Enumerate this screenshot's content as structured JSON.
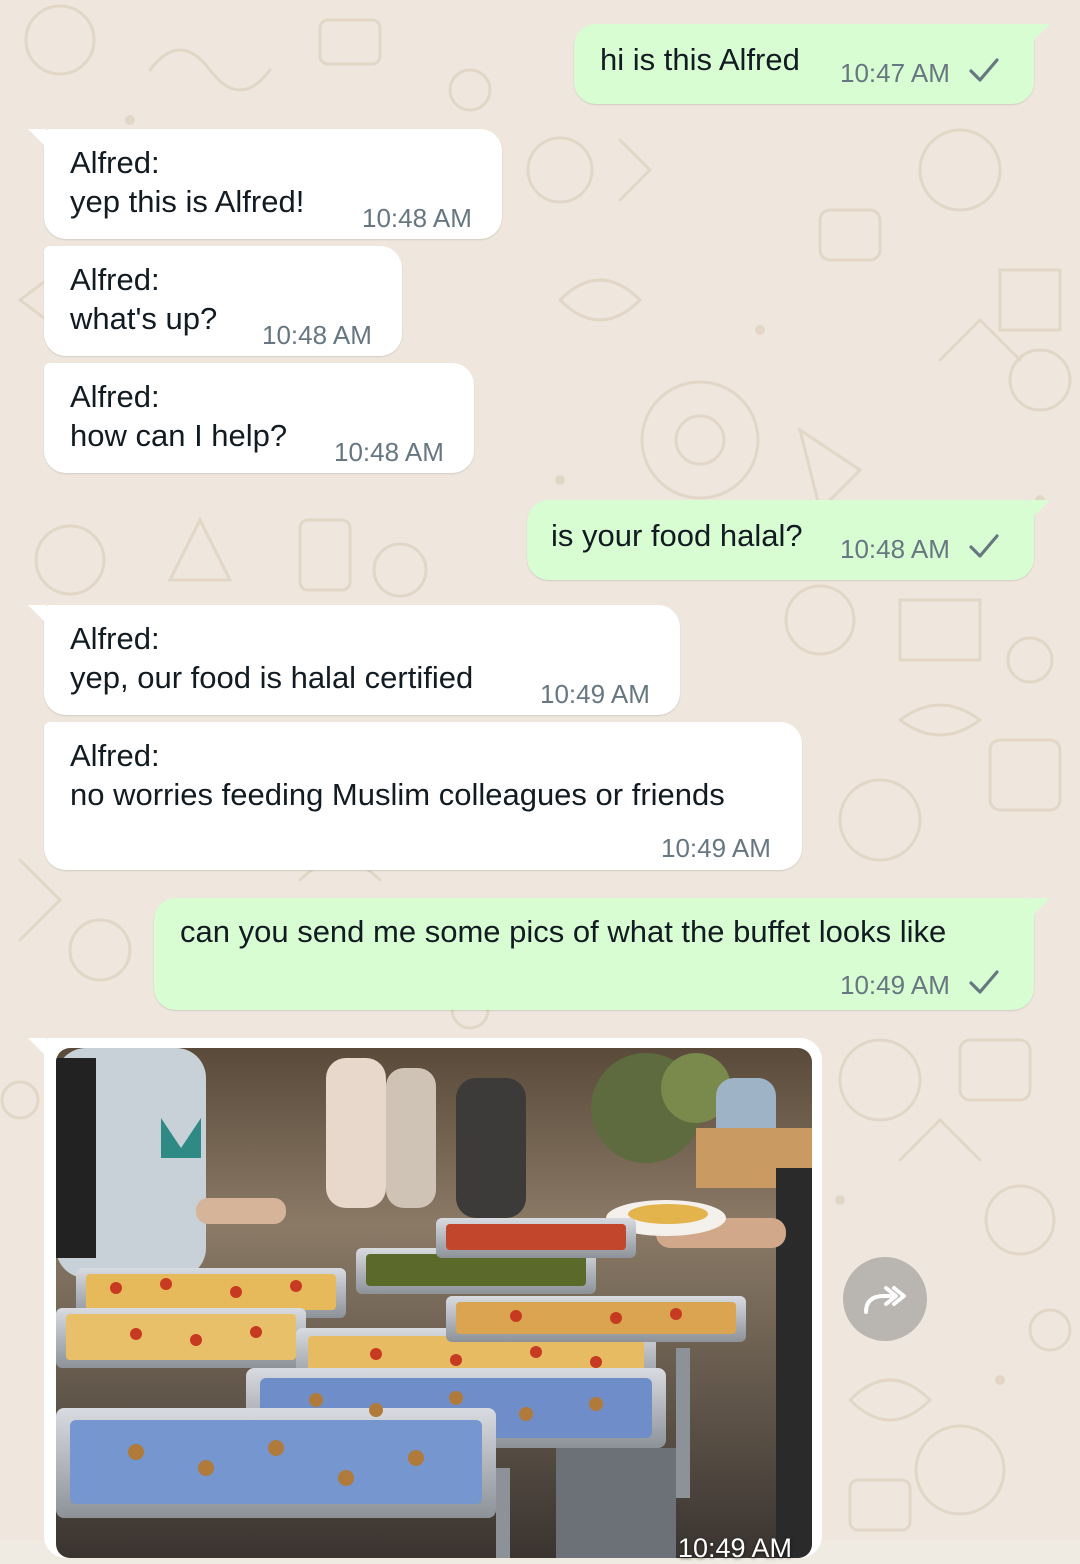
{
  "theme": {
    "outgoing_bubble": "#d9fdd3",
    "incoming_bubble": "#ffffff",
    "wallpaper": "#efeae2",
    "timestamp": "#667781"
  },
  "messages": [
    {
      "direction": "out",
      "text": "hi is this Alfred",
      "time": "10:47 AM",
      "status_icon": "single-check-icon"
    },
    {
      "direction": "in",
      "sender": "Alfred",
      "sender_suffix": ":",
      "text": "yep this is Alfred!",
      "time": "10:48 AM"
    },
    {
      "direction": "in",
      "sender": "Alfred",
      "sender_suffix": ":",
      "text": "what's up?",
      "time": "10:48 AM"
    },
    {
      "direction": "in",
      "sender": "Alfred",
      "sender_suffix": ":",
      "text": "how can I help?",
      "time": "10:48 AM"
    },
    {
      "direction": "out",
      "text": "is your food halal?",
      "time": "10:48 AM",
      "status_icon": "single-check-icon"
    },
    {
      "direction": "in",
      "sender": "Alfred",
      "sender_suffix": ":",
      "text": "yep, our food is halal certified",
      "time": "10:49 AM"
    },
    {
      "direction": "in",
      "sender": "Alfred",
      "sender_suffix": ":",
      "text": "no worries feeding Muslim colleagues or friends",
      "time": "10:49 AM"
    },
    {
      "direction": "out",
      "text": "can you send me some pics of what the buffet looks like",
      "time": "10:49 AM",
      "status_icon": "single-check-icon"
    },
    {
      "direction": "in",
      "type": "image",
      "image_icon": "buffet-photo",
      "time": "10:49 AM"
    }
  ],
  "actions": {
    "forward_icon": "forward-arrow-icon"
  }
}
